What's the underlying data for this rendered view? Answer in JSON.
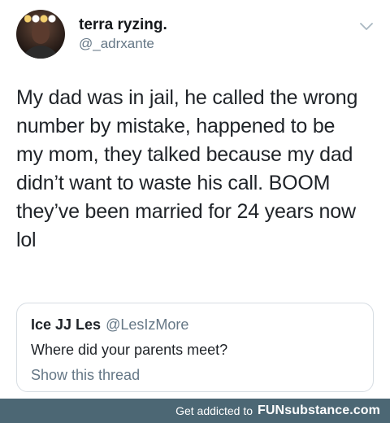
{
  "tweet": {
    "display_name": "terra ryzing.",
    "username": "@_adrxante",
    "text": "My dad was in jail, he called the wrong\nnumber by mistake, happened to be\nmy mom, they talked because my dad\ndidn’t want to waste his call. BOOM\nthey’ve been married for 24 years now\nlol",
    "menu_icon": "chevron-down-icon",
    "colors": {
      "text": "#1f2328",
      "secondary": "#657786"
    }
  },
  "quoted_tweet": {
    "display_name": "Ice JJ Les",
    "username": "@LesIzMore",
    "text": "Where did your parents meet?",
    "link_label": "Show this thread"
  },
  "footer": {
    "tagline": "Get addicted to",
    "brand": "FUNsubstance.com",
    "background": "#4c6774"
  }
}
